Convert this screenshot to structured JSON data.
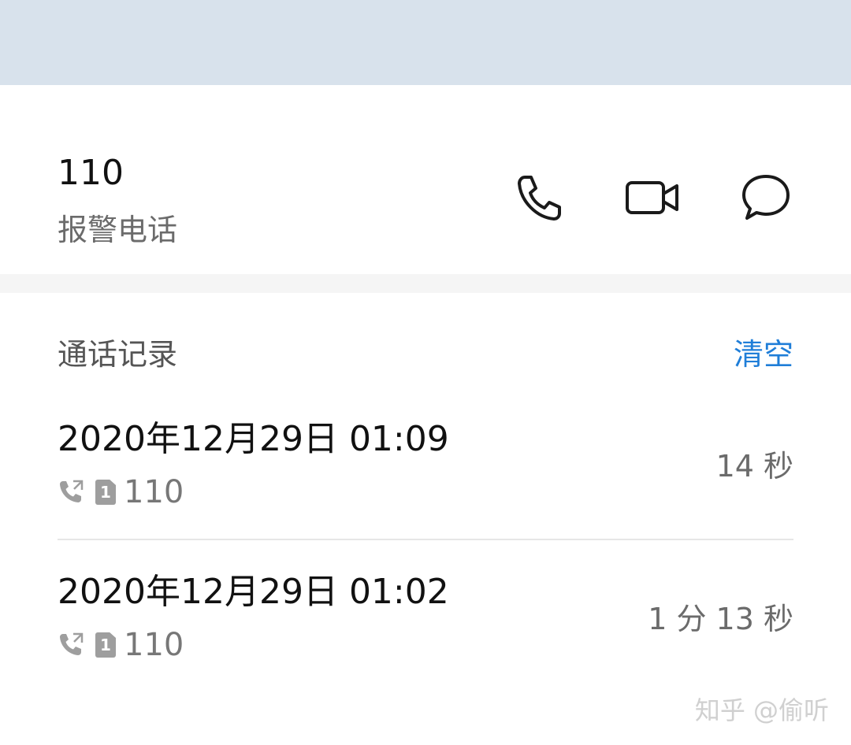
{
  "contact": {
    "number": "110",
    "label": "报警电话"
  },
  "actions": {
    "call_icon": "phone-icon",
    "video_icon": "video-camera-icon",
    "message_icon": "chat-bubble-icon"
  },
  "history": {
    "title": "通话记录",
    "clear_label": "清空",
    "entries": [
      {
        "datetime": "2020年12月29日 01:09",
        "sim": "1",
        "number": "110",
        "duration": "14 秒",
        "call_type_icon": "outgoing-call-icon"
      },
      {
        "datetime": "2020年12月29日 01:02",
        "sim": "1",
        "number": "110",
        "duration": "1 分 13 秒",
        "call_type_icon": "outgoing-call-icon"
      }
    ]
  },
  "watermark": "知乎 @偷听",
  "colors": {
    "top_band": "#d8e2ec",
    "accent": "#1f7ed8",
    "secondary_text": "#6b6b6b"
  }
}
